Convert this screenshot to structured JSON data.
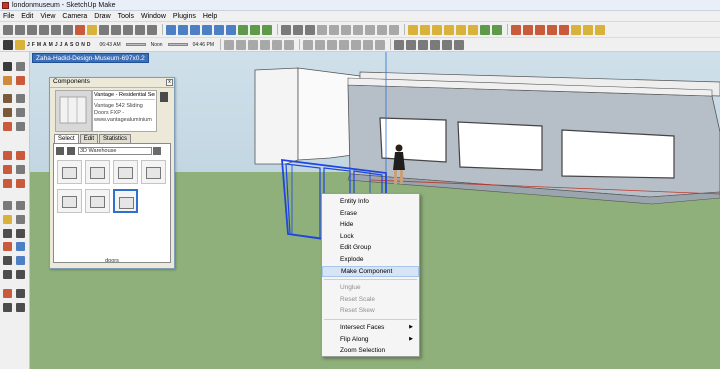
{
  "window": {
    "title": "londonmuseum - SketchUp Make"
  },
  "menubar": [
    "File",
    "Edit",
    "View",
    "Camera",
    "Draw",
    "Tools",
    "Window",
    "Plugins",
    "Help"
  ],
  "shadows": {
    "months": [
      "J",
      "F",
      "M",
      "A",
      "M",
      "J",
      "J",
      "A",
      "S",
      "O",
      "N",
      "D"
    ],
    "time_start": "06:43 AM",
    "time_noon": "Noon",
    "time_end": "04:46 PM"
  },
  "scene": {
    "tab_label": "Zaha-Hadid-Design-Museum-697x0.2"
  },
  "components_panel": {
    "title": "Components",
    "close_label": "x",
    "selected_name": "Vantage - Residential Seri",
    "description": "Vantage 542 Sliding Doors FXP -",
    "url": "www.vantagealuminium",
    "tabs": [
      "Select",
      "Edit",
      "Statistics"
    ],
    "search_value": "3D Warehouse",
    "footer": "doors"
  },
  "context_menu": {
    "items": [
      {
        "label": "Entity Info",
        "disabled": false
      },
      {
        "label": "Erase",
        "disabled": false
      },
      {
        "label": "Hide",
        "disabled": false
      },
      {
        "label": "Lock",
        "disabled": false
      },
      {
        "label": "Edit Group",
        "disabled": false
      },
      {
        "label": "Explode",
        "disabled": false
      },
      {
        "label": "Make Component",
        "disabled": false,
        "hover": true
      }
    ],
    "items2": [
      {
        "label": "Unglue",
        "disabled": true
      },
      {
        "label": "Reset Scale",
        "disabled": true
      },
      {
        "label": "Reset Skew",
        "disabled": true
      }
    ],
    "items3": [
      {
        "label": "Intersect Faces",
        "submenu": true
      },
      {
        "label": "Flip Along",
        "submenu": true
      },
      {
        "label": "Zoom Selection",
        "submenu": false
      }
    ]
  },
  "colors": {
    "selection_blue": "#1f47e0",
    "ground": "#8fb07a",
    "sky": "#c6d9e4"
  }
}
